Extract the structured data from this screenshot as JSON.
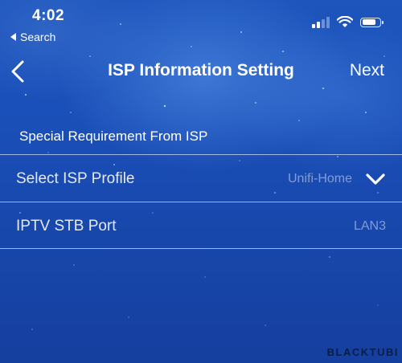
{
  "status_bar": {
    "time": "4:02",
    "back_app_label": "Search",
    "icons": [
      "signal-icon",
      "wifi-icon",
      "battery-icon"
    ],
    "battery_level": 0.8
  },
  "nav": {
    "title": "ISP Information Setting",
    "next_label": "Next",
    "back_icon": "chevron-left-icon"
  },
  "section": {
    "header": "Special Requirement From ISP"
  },
  "rows": [
    {
      "label": "Select ISP Profile",
      "value": "Unifi-Home",
      "icon": "chevron-down-icon"
    },
    {
      "label": "IPTV STB Port",
      "value": "LAN3"
    }
  ],
  "watermark": "BLACKTUBI",
  "colors": {
    "background": "#1a4fb8",
    "text": "#ffffff"
  }
}
